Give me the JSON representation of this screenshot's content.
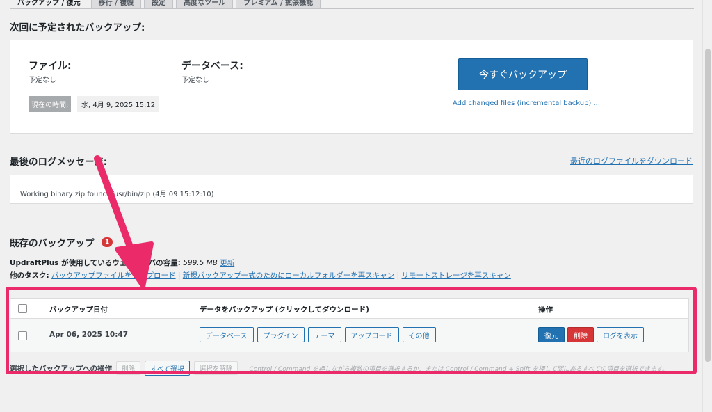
{
  "tabs": [
    {
      "label": "バックアップ / 復元"
    },
    {
      "label": "移行 / 複製"
    },
    {
      "label": "設定"
    },
    {
      "label": "高度なツール"
    },
    {
      "label": "プレミアム / 拡張機能"
    }
  ],
  "schedule": {
    "heading": "次回に予定されたバックアップ:",
    "files_label": "ファイル:",
    "files_value": "予定なし",
    "db_label": "データベース:",
    "db_value": "予定なし",
    "now_label": "現在の時間:",
    "now_value": "水, 4月 9, 2025 15:12",
    "backup_now": "今すぐバックアップ",
    "incremental_link": "Add changed files (incremental backup) ..."
  },
  "log": {
    "heading": "最後のログメッセージ:",
    "download_link": "最近のログファイルをダウンロード",
    "message": "Working binary zip found: /usr/bin/zip (4月 09 15:12:10)"
  },
  "existing": {
    "heading": "既存のバックアップ",
    "badge_count": "1",
    "storage_label": "UpdraftPlus が使用しているウェブサーバの容量:",
    "storage_value": "599.5 MB",
    "refresh_link": "更新",
    "other_tasks_label": "他のタスク:",
    "task_upload": "バックアップファイルをアップロード",
    "separator": "|",
    "task_rescan_local": "新規バックアップ一式のためにローカルフォルダーを再スキャン",
    "task_rescan_remote": "リモートストレージを再スキャン"
  },
  "table": {
    "col_date": "バックアップ日付",
    "col_data": "データをバックアップ (クリックしてダウンロード)",
    "col_actions": "操作",
    "rows": [
      {
        "date": "Apr 06, 2025 10:47",
        "downloads": [
          "データベース",
          "プラグイン",
          "テーマ",
          "アップロード",
          "その他"
        ],
        "restore": "復元",
        "delete": "削除",
        "view_log": "ログを表示"
      }
    ]
  },
  "bulk": {
    "label": "選択したバックアップへの操作",
    "delete": "削除",
    "select_all": "すべて選択",
    "deselect": "選択を解除",
    "hint": "Control / Command を押しながら複数の項目を選択するか、または Control / Command + Shift を押して間にあるすべての項目を選択できます。"
  },
  "colors": {
    "accent": "#2271b1",
    "danger": "#d63638",
    "annotation": "#ea2a69"
  }
}
